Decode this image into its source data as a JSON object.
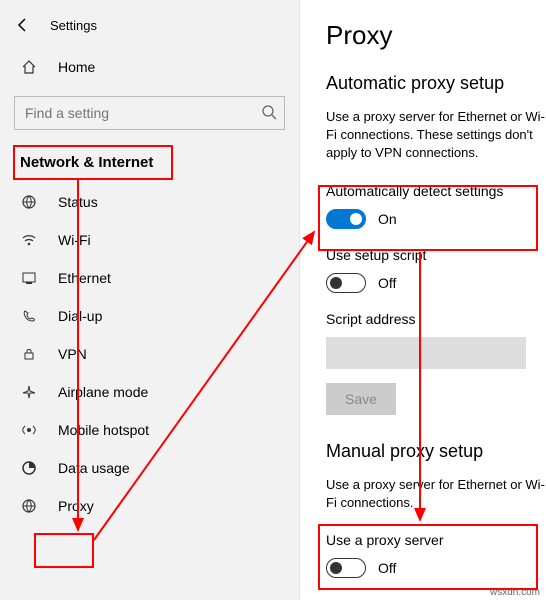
{
  "app_title": "Settings",
  "sidebar": {
    "home_label": "Home",
    "search_placeholder": "Find a setting",
    "category_label": "Network & Internet",
    "items": [
      {
        "label": "Status"
      },
      {
        "label": "Wi-Fi"
      },
      {
        "label": "Ethernet"
      },
      {
        "label": "Dial-up"
      },
      {
        "label": "VPN"
      },
      {
        "label": "Airplane mode"
      },
      {
        "label": "Mobile hotspot"
      },
      {
        "label": "Data usage"
      },
      {
        "label": "Proxy"
      }
    ]
  },
  "content": {
    "page_title": "Proxy",
    "auto_section": {
      "heading": "Automatic proxy setup",
      "desc": "Use a proxy server for Ethernet or Wi-Fi connections. These settings don't apply to VPN connections.",
      "auto_detect_label": "Automatically detect settings",
      "auto_detect_state": "On",
      "use_script_label": "Use setup script",
      "use_script_state": "Off",
      "script_address_label": "Script address",
      "save_label": "Save"
    },
    "manual_section": {
      "heading": "Manual proxy setup",
      "desc": "Use a proxy server for Ethernet or Wi-Fi connections.",
      "use_proxy_label": "Use a proxy server",
      "use_proxy_state": "Off"
    }
  },
  "watermark": "wsxdn.com"
}
